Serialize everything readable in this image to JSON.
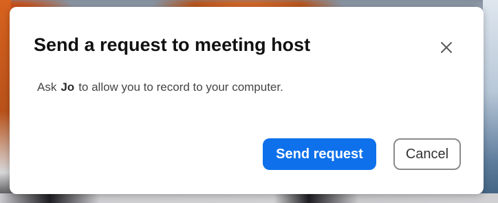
{
  "dialog": {
    "title": "Send a request to meeting host",
    "close_icon": "close-icon",
    "message": {
      "prefix": "Ask",
      "host_name": "Jo",
      "suffix": "to allow you to record to your computer."
    },
    "buttons": {
      "send_label": "Send request",
      "cancel_label": "Cancel"
    }
  },
  "colors": {
    "primary_button": "#0e71eb",
    "dialog_bg": "#ffffff",
    "cancel_border": "#8a8a8a"
  }
}
